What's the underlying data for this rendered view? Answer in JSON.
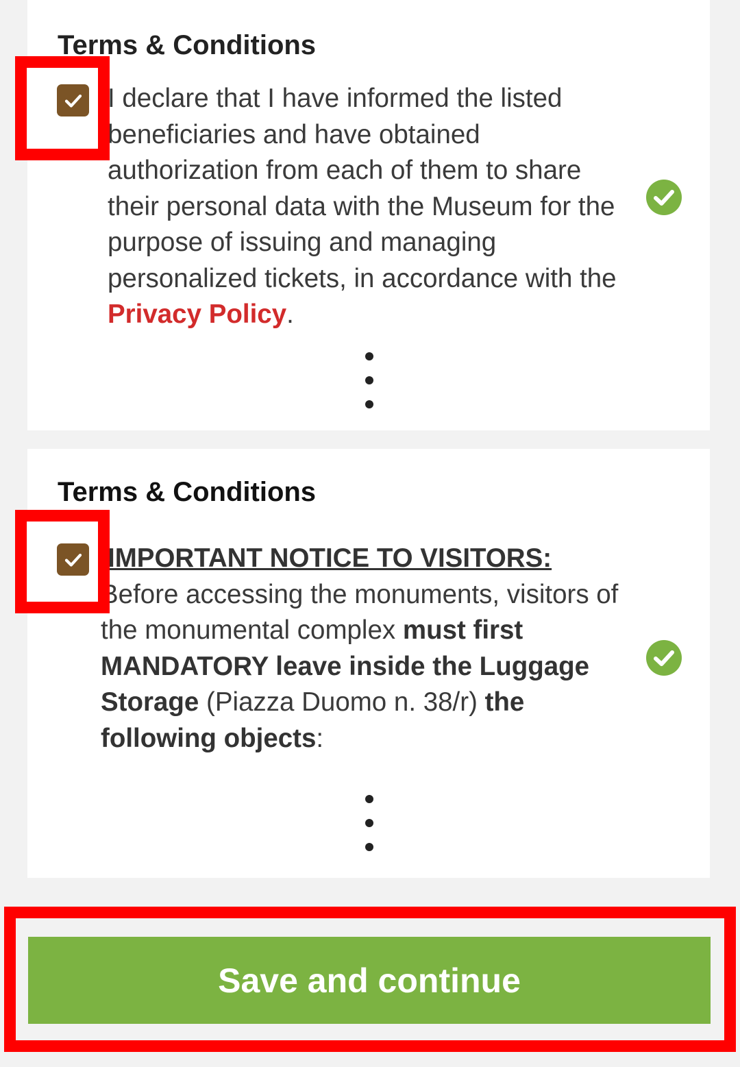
{
  "colors": {
    "page_background": "#f2f2f2",
    "card_background": "#ffffff",
    "checkbox_fill": "#7b5426",
    "link_red": "#d22b2b",
    "valid_green": "#7cb342",
    "button_green": "#7cb342",
    "highlight_red": "#ff0000"
  },
  "sections": [
    {
      "title": "Terms & Conditions",
      "checkbox": {
        "checked": true,
        "icon": "check-icon"
      },
      "text_before_link": "I declare that I have informed the listed beneficiaries and have obtained authorization from each of them to share their personal data with the Museum for the purpose of issuing and managing personalized tickets, in accordance with the ",
      "link_text": "Privacy Policy",
      "text_after_link": ".",
      "status_icon": "check-circle-icon",
      "more_icon": "vertical-dots-icon"
    },
    {
      "title": "Terms & Conditions",
      "checkbox": {
        "checked": true,
        "icon": "check-icon"
      },
      "notice_title": "IMPORTANT NOTICE TO VISITORS:",
      "text_part1": "Before accessing the monuments, visitors of the monumental complex ",
      "bold_part1": "must first MANDATORY leave inside the Luggage Storage",
      "text_part2": " (Piazza Duomo n. 38/r) ",
      "bold_part2": "the following objects",
      "text_part3": ":",
      "status_icon": "check-circle-icon",
      "more_icon": "vertical-dots-icon"
    }
  ],
  "save_button": {
    "label": "Save and continue"
  }
}
